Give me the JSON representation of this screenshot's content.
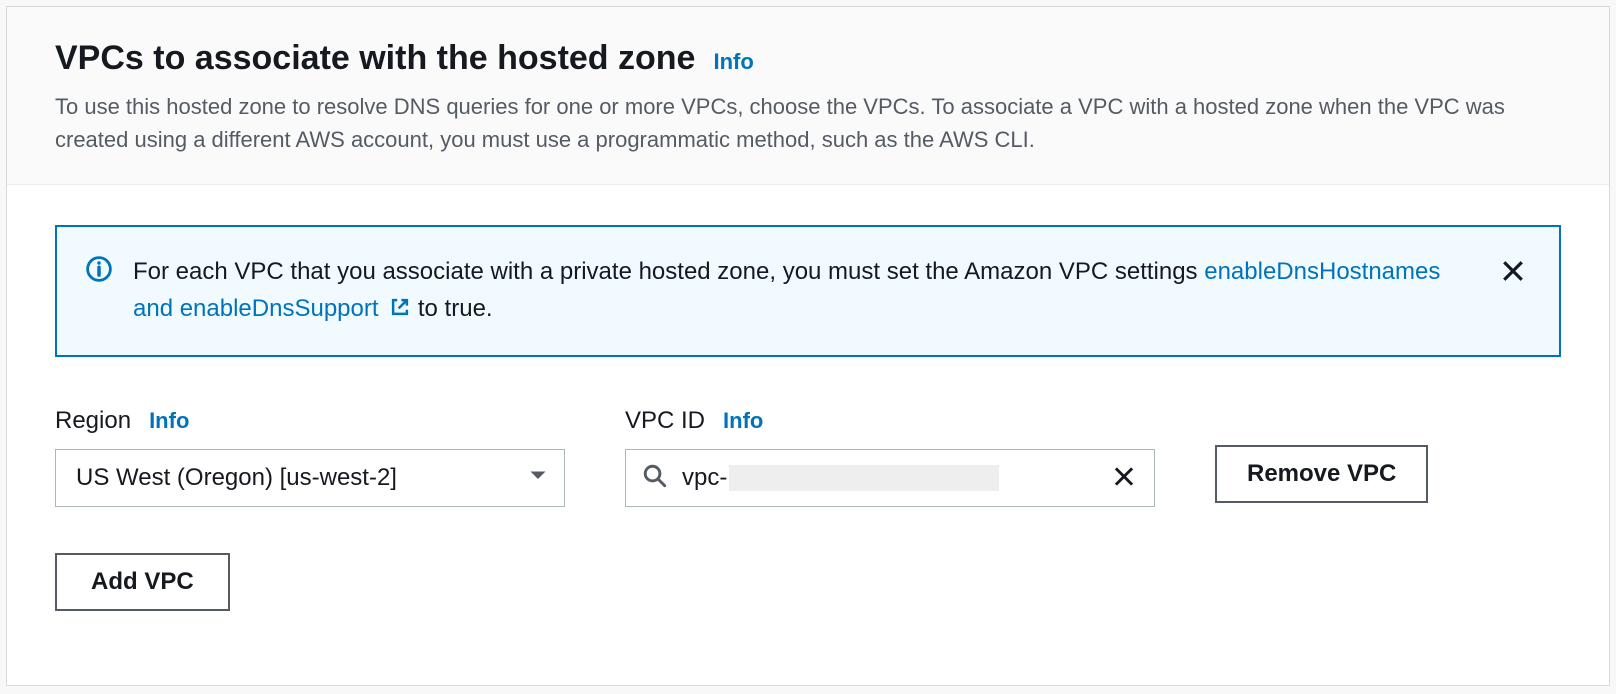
{
  "header": {
    "title": "VPCs to associate with the hosted zone",
    "info_label": "Info",
    "description": "To use this hosted zone to resolve DNS queries for one or more VPCs, choose the VPCs. To associate a VPC with a hosted zone when the VPC was created using a different AWS account, you must use a programmatic method, such as the AWS CLI."
  },
  "alert": {
    "text_before": "For each VPC that you associate with a private hosted zone, you must set the Amazon VPC settings ",
    "link_text": "enableDnsHostnames and enableDnsSupport",
    "text_after": " to true."
  },
  "region": {
    "label": "Region",
    "info_label": "Info",
    "value": "US West (Oregon) [us-west-2]"
  },
  "vpc_id": {
    "label": "VPC ID",
    "info_label": "Info",
    "value_prefix": "vpc-"
  },
  "buttons": {
    "remove": "Remove VPC",
    "add": "Add VPC"
  }
}
